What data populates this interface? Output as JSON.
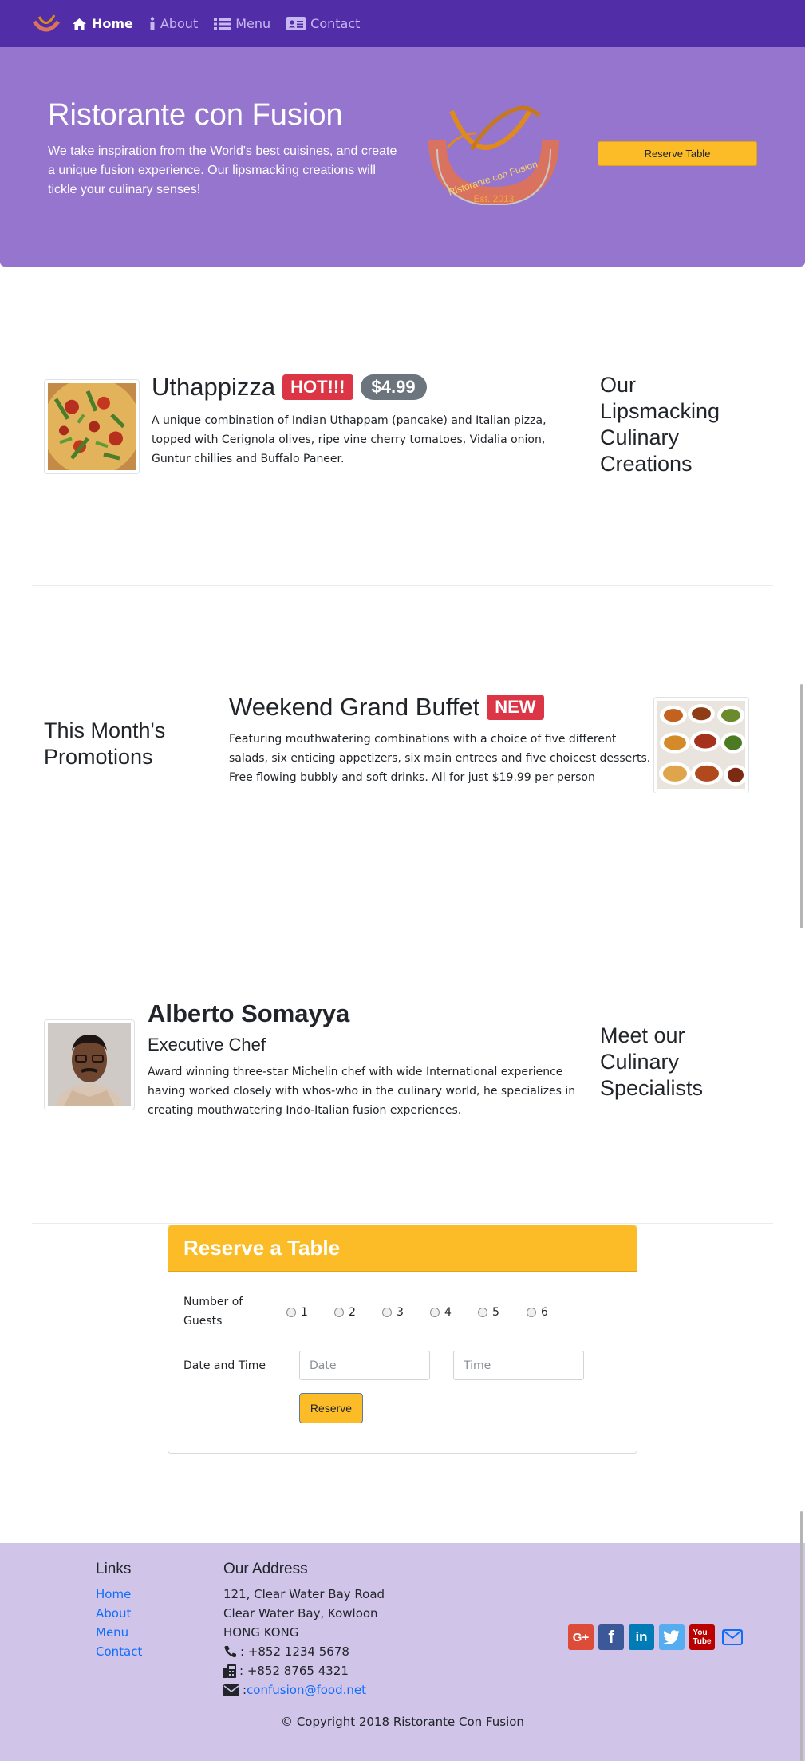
{
  "nav": {
    "items": [
      {
        "label": "Home",
        "icon": "home-icon"
      },
      {
        "label": "About",
        "icon": "info-icon"
      },
      {
        "label": "Menu",
        "icon": "list-icon"
      },
      {
        "label": "Contact",
        "icon": "address-card-icon"
      }
    ]
  },
  "jumbotron": {
    "title": "Ristorante con Fusion",
    "text": "We take inspiration from the World's best cuisines, and create a unique fusion experience. Our lipsmacking creations will tickle your culinary senses!",
    "logo_text": "Ristorante con Fusion",
    "logo_est": "Est. 2013",
    "reserve_button": "Reserve Table"
  },
  "dish": {
    "name": "Uthappizza",
    "label": "HOT!!!",
    "price": "$4.99",
    "description": "A unique combination of Indian Uthappam (pancake) and Italian pizza, topped with Cerignola olives, ripe vine cherry tomatoes, Vidalia onion, Guntur chillies and Buffalo Paneer.",
    "side_heading": "Our Lipsmacking Culinary Creations"
  },
  "promotion": {
    "side_heading": "This Month's Promotions",
    "name": "Weekend Grand Buffet",
    "label": "NEW",
    "description": "Featuring mouthwatering combinations with a choice of five different salads, six enticing appetizers, six main entrees and five choicest desserts. Free flowing bubbly and soft drinks. All for just $19.99 per person"
  },
  "leader": {
    "name": "Alberto Somayya",
    "designation": "Executive Chef",
    "description": "Award winning three-star Michelin chef with wide International experience having worked closely with whos-who in the culinary world, he specializes in creating mouthwatering Indo-Italian fusion experiences.",
    "side_heading": "Meet our Culinary Specialists"
  },
  "reserve": {
    "title": "Reserve a Table",
    "guests_label": "Number of Guests",
    "guest_options": [
      "1",
      "2",
      "3",
      "4",
      "5",
      "6"
    ],
    "datetime_label": "Date and Time",
    "date_placeholder": "Date",
    "time_placeholder": "Time",
    "button": "Reserve"
  },
  "footer": {
    "links_heading": "Links",
    "links": [
      "Home",
      "About",
      "Menu",
      "Contact"
    ],
    "address_heading": "Our Address",
    "address_lines": [
      "121, Clear Water Bay Road",
      "Clear Water Bay, Kowloon",
      "HONG KONG"
    ],
    "phone": ": +852 1234 5678",
    "fax": ": +852 8765 4321",
    "email_prefix": ": ",
    "email": "confusion@food.net",
    "social": [
      "google-plus-icon",
      "facebook-icon",
      "linkedin-icon",
      "twitter-icon",
      "youtube-icon",
      "mail-icon"
    ],
    "copyright": "© Copyright 2018 Ristorante Con Fusion"
  },
  "colors": {
    "navbar": "#512da8",
    "jumbotron": "#9575cd",
    "accent": "#fbbc27",
    "footer": "#d1c4e9",
    "badge_red": "#dc3545",
    "badge_gray": "#6c757d",
    "link": "#0d6efd"
  }
}
